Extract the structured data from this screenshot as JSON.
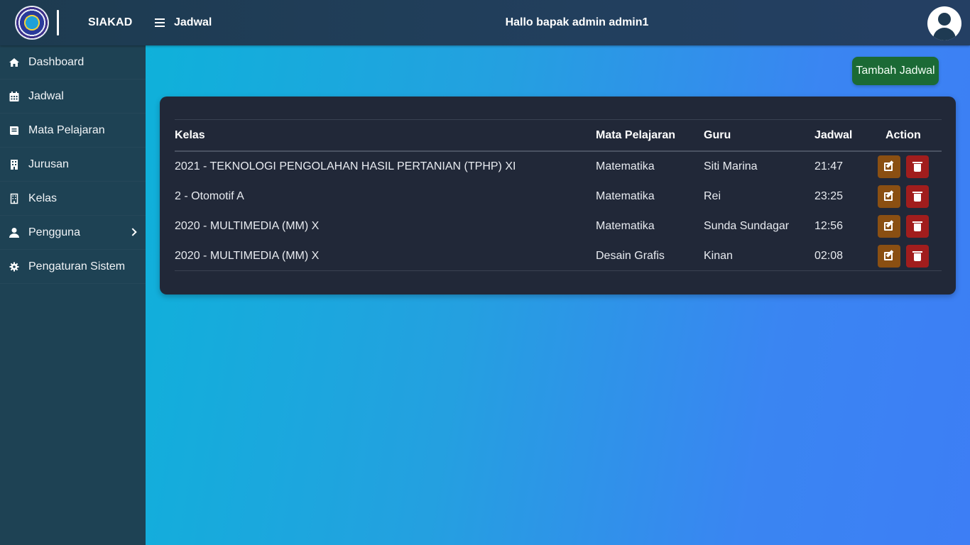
{
  "header": {
    "app_name": "SIAKAD",
    "page_title": "Jadwal",
    "greeting": "Hallo bapak admin admin1",
    "icons": {
      "logo": "school-logo",
      "menu": "hamburger-icon",
      "avatar": "user-circle-icon"
    }
  },
  "sidebar": {
    "items": [
      {
        "label": "Dashboard",
        "icon": "home-icon"
      },
      {
        "label": "Jadwal",
        "icon": "calendar-icon"
      },
      {
        "label": "Mata Pelajaran",
        "icon": "book-icon"
      },
      {
        "label": "Jurusan",
        "icon": "building-icon"
      },
      {
        "label": "Kelas",
        "icon": "building-outline-icon"
      },
      {
        "label": "Pengguna",
        "icon": "user-icon",
        "has_submenu": true
      },
      {
        "label": "Pengaturan Sistem",
        "icon": "gear-icon"
      }
    ]
  },
  "main": {
    "add_button": "Tambah Jadwal",
    "table": {
      "headers": {
        "kelas": "Kelas",
        "mapel": "Mata Pelajaran",
        "guru": "Guru",
        "jadwal": "Jadwal",
        "action": "Action"
      },
      "rows": [
        {
          "kelas": "2021 - TEKNOLOGI PENGOLAHAN HASIL PERTANIAN (TPHP) XI",
          "mapel": "Matematika",
          "guru": "Siti Marina",
          "jadwal": "21:47"
        },
        {
          "kelas": "2 - Otomotif A",
          "mapel": "Matematika",
          "guru": "Rei",
          "jadwal": "23:25"
        },
        {
          "kelas": "2020 - MULTIMEDIA (MM) X",
          "mapel": "Matematika",
          "guru": "Sunda Sundagar",
          "jadwal": "12:56"
        },
        {
          "kelas": "2020 - MULTIMEDIA (MM) X",
          "mapel": "Desain Grafis",
          "guru": "Kinan",
          "jadwal": "02:08"
        }
      ]
    }
  },
  "colors": {
    "sidebar_bg": "#1e4254",
    "header_bg": "#223f5d",
    "card_bg": "#212838",
    "add_button": "#1b6a35",
    "edit_button": "#8a4f12",
    "delete_button": "#a11d1d"
  }
}
